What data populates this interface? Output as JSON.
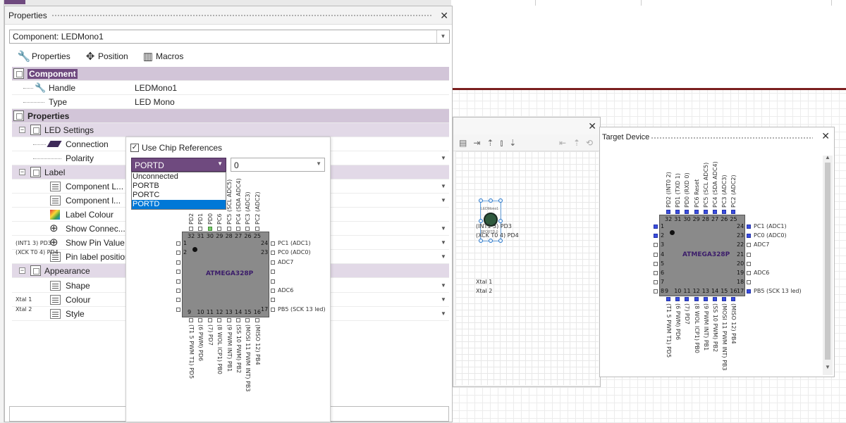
{
  "properties_panel": {
    "title": "Properties",
    "component_select": "Component: LEDMono1",
    "tabs": [
      {
        "label": "Properties",
        "icon": "wrench-icon"
      },
      {
        "label": "Position",
        "icon": "move-icon"
      },
      {
        "label": "Macros",
        "icon": "macros-icon"
      }
    ],
    "rows": {
      "component_section": "Component",
      "handle_label": "Handle",
      "handle_value": "LEDMono1",
      "type_label": "Type",
      "type_value": "LED Mono",
      "properties_section": "Properties",
      "led_settings": "LED Settings",
      "connection": "Connection",
      "polarity": "Polarity",
      "label_section": "Label",
      "component_l1": "Component L...",
      "component_l2": "Component l...",
      "label_colour": "Label Colour",
      "show_connect": "Show Connec...",
      "show_pin_value": "Show Pin Value",
      "pin_label_position": "Pin label position",
      "appearance": "Appearance",
      "shape": "Shape",
      "colour": "Colour",
      "style": "Style"
    }
  },
  "connection_popup": {
    "use_chip_refs": "Use Chip References",
    "port_selected": "PORTD",
    "pin_selected": "0",
    "port_options": [
      "Unconnected",
      "PORTB",
      "PORTC",
      "PORTD"
    ],
    "chip": {
      "name": "ATMEGA328P",
      "top_labels": [
        "PD2",
        "PD1",
        "PD0",
        "PC6",
        "PC5 (SCL ADC5)",
        "PC4 (SDA ADC4)",
        "PC3 (ADC3)",
        "PC2 (ADC2)"
      ],
      "top_nums": [
        "32",
        "31",
        "30",
        "29",
        "28",
        "27",
        "26",
        "25"
      ],
      "left_labels": [
        "(INT1 3) PD3",
        "(XCK T0 4) PD4",
        "Xtal 1",
        "Xtal 2"
      ],
      "left_nums": [
        "1",
        "2"
      ],
      "right_labels": [
        "PC1 (ADC1)",
        "PC0 (ADC0)",
        "ADC7",
        "ADC6",
        "PB5 (SCK 13 led)"
      ],
      "right_nums": [
        "24",
        "23",
        "17"
      ],
      "bottom_nums": [
        "9",
        "10",
        "11",
        "12",
        "13",
        "14",
        "15",
        "16"
      ],
      "bottom_labels": [
        "(T1 5 PWM T1) PD5",
        "(6 PWM) PD6",
        "(7) PD7",
        "(8 WOL ICP1) PB0",
        "(9 PWM INT) PB1",
        "(SS 10 PWM) PB2",
        "(MOSI 11 PWM INT) PB3",
        "(MISO 12) PB4"
      ]
    }
  },
  "mid_panel": {
    "led_label": "LEDMono1",
    "led_port": "$PORTD.0"
  },
  "target_panel": {
    "title": "Target Device",
    "chip": {
      "name": "ATMEGA328P",
      "top_labels": [
        "PD2 (INT0 2)",
        "PD1 (TXD 1)",
        "PD0 (RXD 0)",
        "PC6 Reset",
        "PC5 (SCL ADC5)",
        "PC4 (SDA ADC4)",
        "PC3 (ADC3)",
        "PC2 (ADC2)"
      ],
      "top_nums": [
        "32",
        "31",
        "30",
        "29",
        "28",
        "27",
        "26",
        "25"
      ],
      "left_nums": [
        "1",
        "2",
        "3",
        "4",
        "5",
        "6",
        "7",
        "8"
      ],
      "left_labels": [
        "(INT1 3) PD3",
        "(XCK T0 4) PD4",
        "Xtal 1",
        "Xtal 2"
      ],
      "right_nums": [
        "24",
        "23",
        "22",
        "21",
        "20",
        "19",
        "18",
        "17"
      ],
      "right_labels": [
        "PC1 (ADC1)",
        "PC0 (ADC0)",
        "ADC7",
        "ADC6",
        "PB5 (SCK 13 led)"
      ],
      "bottom_nums": [
        "9",
        "10",
        "11",
        "12",
        "13",
        "14",
        "15",
        "16"
      ],
      "bottom_labels": [
        "(T1 5 PWM T1) PD5",
        "(6 PWM) PD6",
        "(7) PD7",
        "(8 WOL ICP1) PB0",
        "(9 PWM INT) PB1",
        "(SS 10 PWM) PB2",
        "(MOSI 11 PWM INT) PB3",
        "(MISO 12) PB4"
      ]
    }
  },
  "colors": {
    "section": "#d2c5d8",
    "selected_port": "#6f4a7f",
    "pin_on": "#3b4ee0",
    "highlight": "#0078d7"
  }
}
